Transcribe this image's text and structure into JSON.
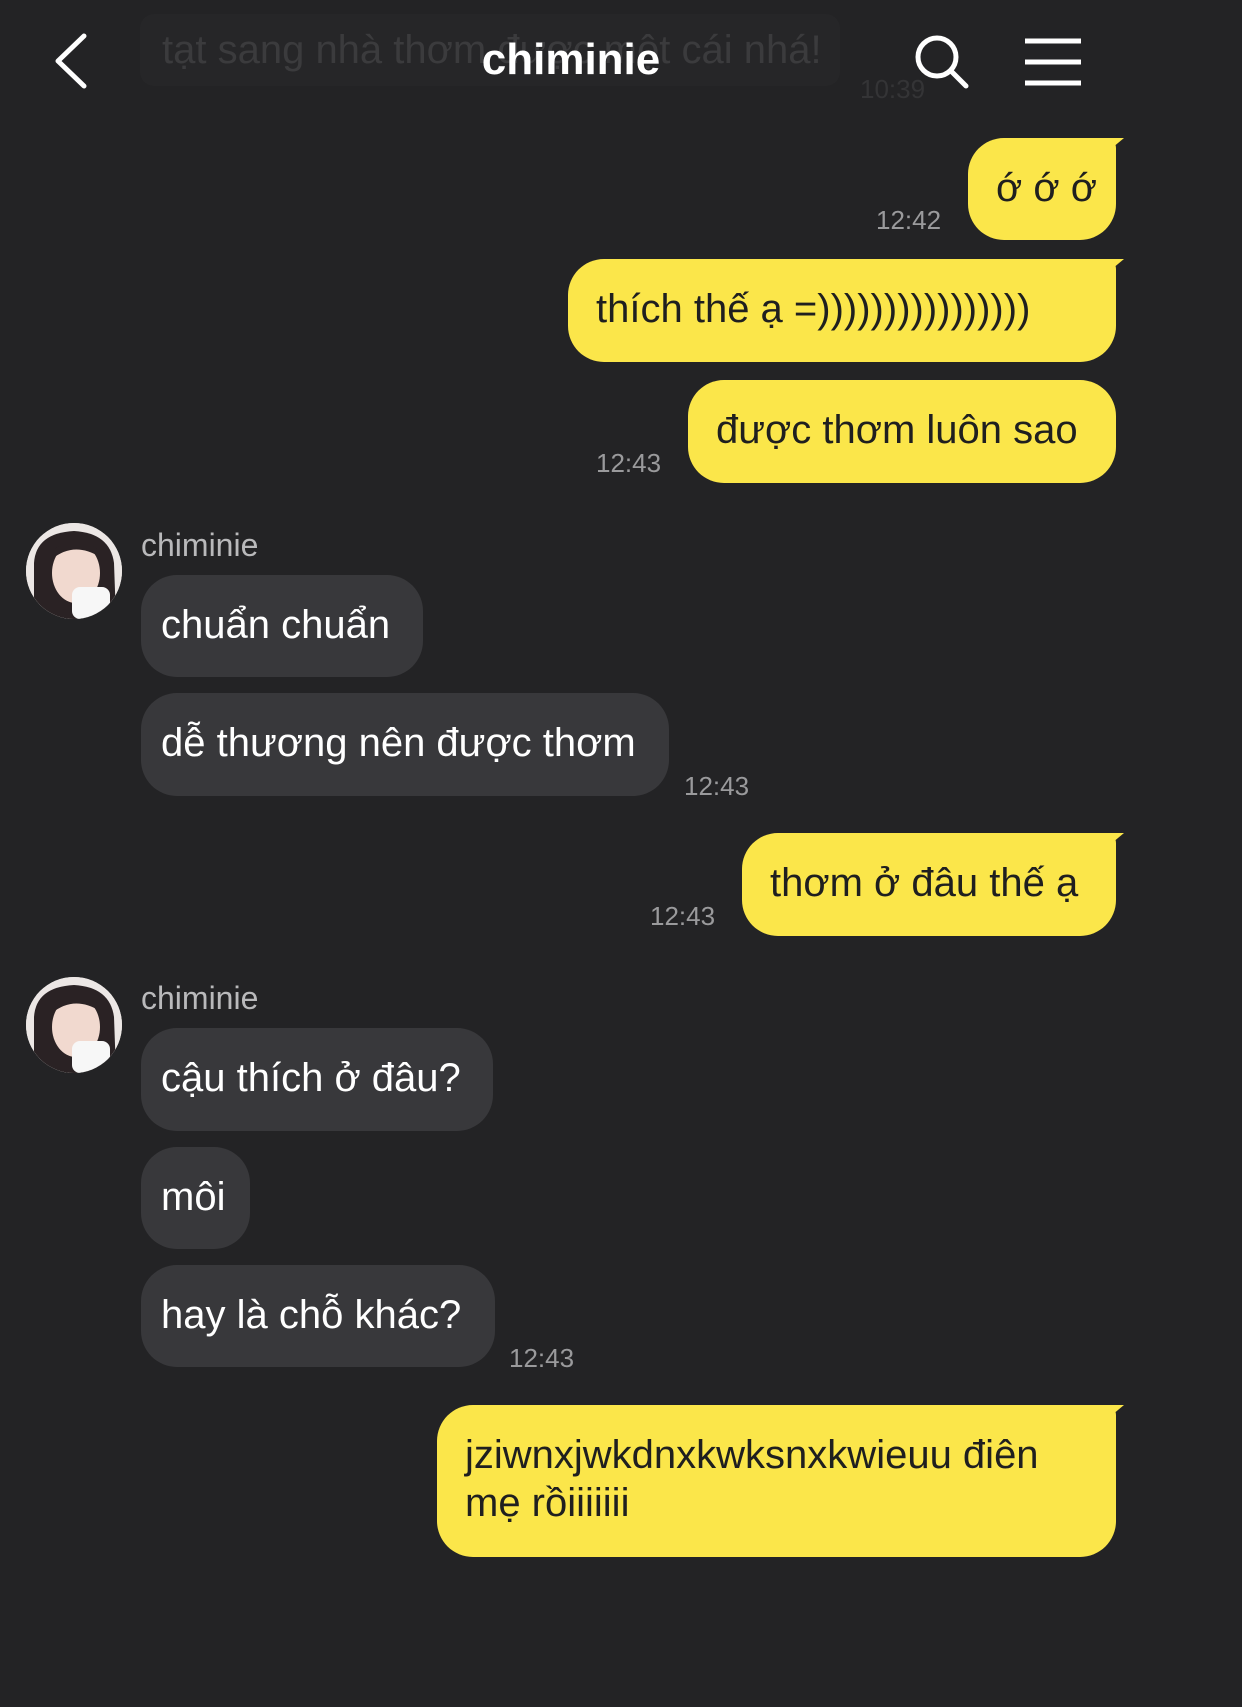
{
  "header": {
    "title": "chiminie",
    "ghost_message": "tạt sang nhà thơm được một cái nhá!",
    "ghost_time": "10:39",
    "back_icon": "chevron-left-icon",
    "search_icon": "search-icon",
    "menu_icon": "hamburger-menu-icon"
  },
  "colors": {
    "background": "#232325",
    "outgoing_bubble": "#fbe64a",
    "incoming_bubble": "#38383b",
    "timestamp": "#9a9a9c"
  },
  "messages": [
    {
      "from": "me",
      "text": "ớ ớ ớ",
      "time": "12:42"
    },
    {
      "from": "me",
      "text": "thích thế ạ =))))))))))))))))",
      "time": ""
    },
    {
      "from": "me",
      "text": "được thơm luôn sao",
      "time": "12:43"
    },
    {
      "from": "them",
      "sender": "chiminie",
      "text": "chuẩn chuẩn",
      "time": ""
    },
    {
      "from": "them",
      "text": "dễ thương nên được thơm",
      "time": "12:43"
    },
    {
      "from": "me",
      "text": "thơm ở đâu thế ạ",
      "time": "12:43"
    },
    {
      "from": "them",
      "sender": "chiminie",
      "text": "cậu thích ở đâu?",
      "time": ""
    },
    {
      "from": "them",
      "text": "môi",
      "time": ""
    },
    {
      "from": "them",
      "text": "hay là chỗ khác?",
      "time": "12:43"
    },
    {
      "from": "me",
      "text": "jziwnxjwkdnxkwksnxkwieuu điên mẹ rồiiiiiii",
      "time": ""
    }
  ]
}
